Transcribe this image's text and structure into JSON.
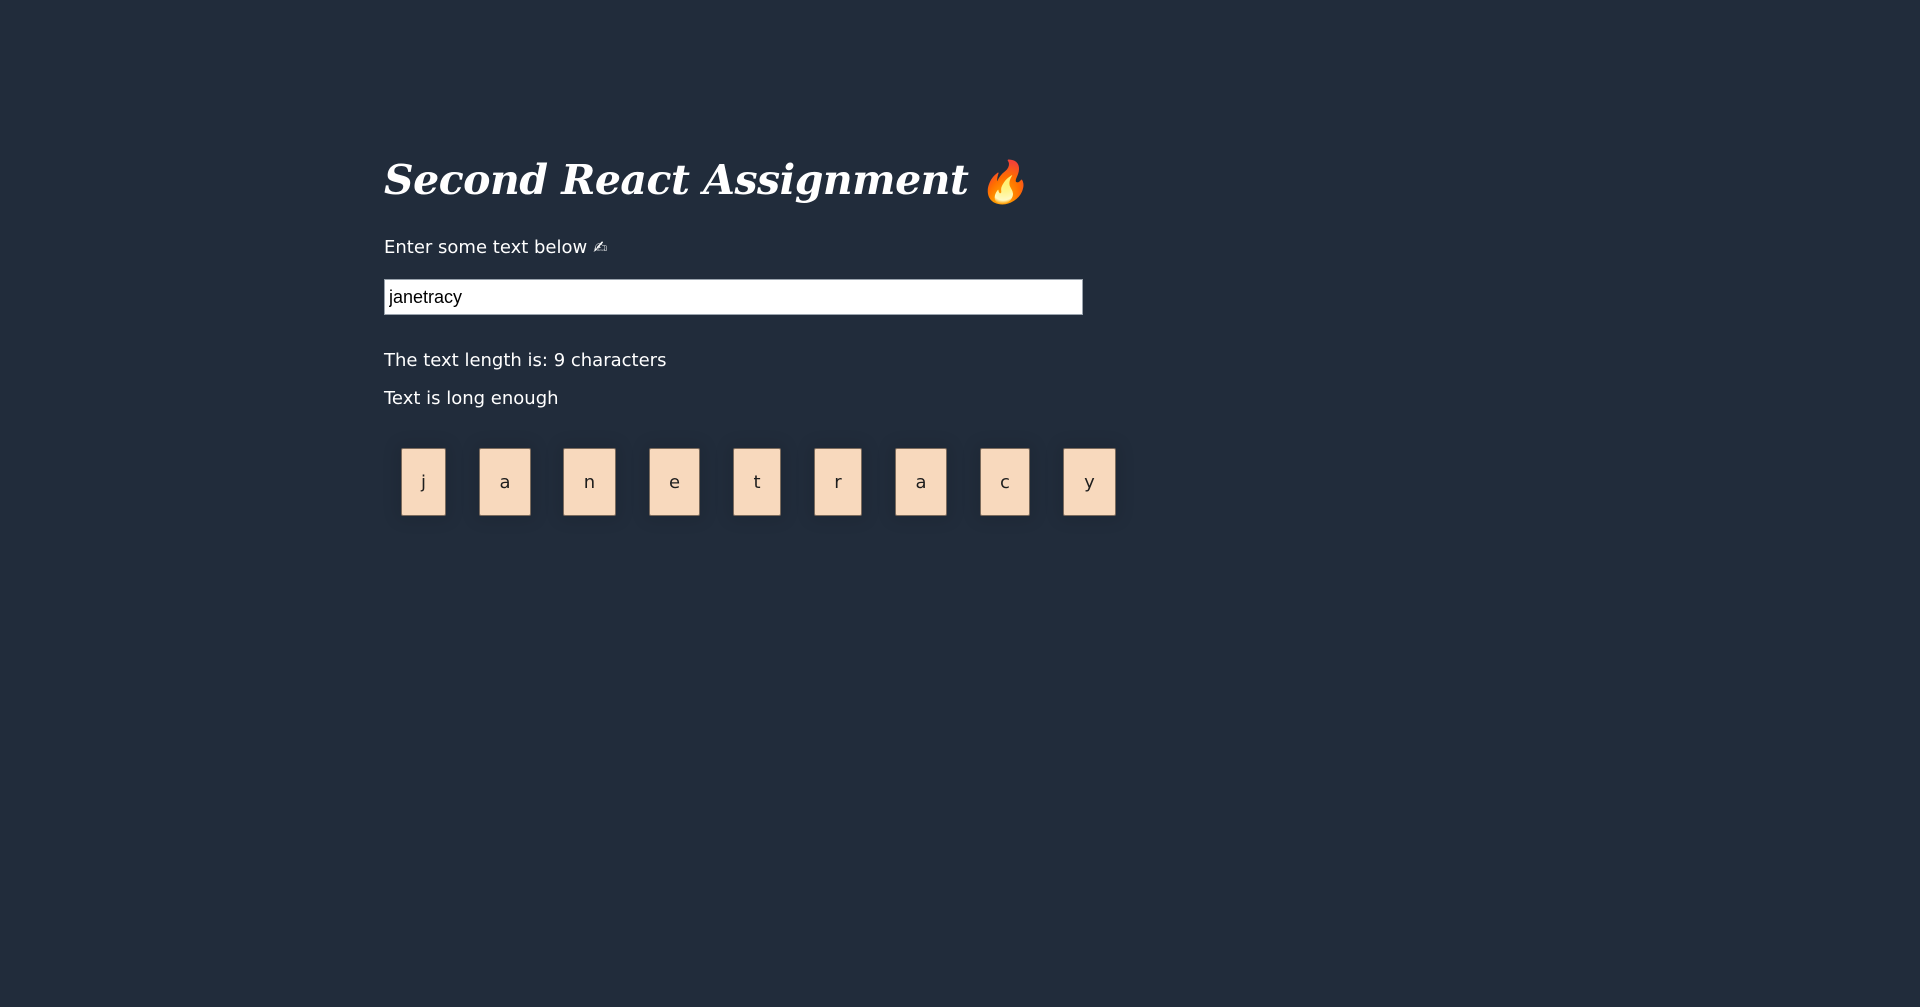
{
  "header": {
    "title": "Second React Assignment",
    "title_emoji": "🔥"
  },
  "form": {
    "prompt": "Enter some text below",
    "prompt_emoji": "✍",
    "input_value": "janetracy"
  },
  "output": {
    "length_text": "The text length is: 9 characters",
    "validation_text": "Text is long enough"
  },
  "chars": [
    "j",
    "a",
    "n",
    "e",
    "t",
    "r",
    "a",
    "c",
    "y"
  ],
  "colors": {
    "background": "#212c3b",
    "char_box": "#f8d9bd",
    "text": "#ffffff"
  }
}
